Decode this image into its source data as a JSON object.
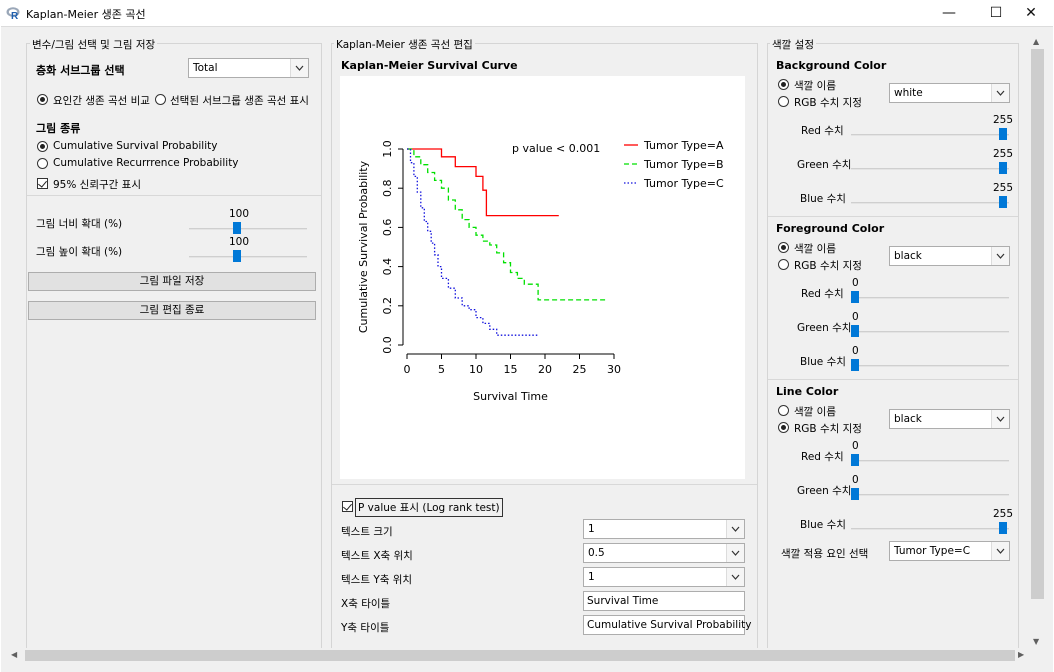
{
  "window": {
    "title": "Kaplan-Meier 생존 곡선",
    "minimize": "—",
    "maximize": "☐",
    "close": "✕"
  },
  "left": {
    "legend": "변수/그림 선택 및 그림 저장",
    "subgroup_label": "층화 서브그룹 선택",
    "subgroup_value": "Total",
    "radio_compare": "요인간 생존 곡선 비교",
    "radio_selected": "선택된 서브그룹 생존 곡선 표시",
    "figure_type_label": "그림 종류",
    "opt_survival": "Cumulative Survival Probability",
    "opt_recurrence": "Cumulative Recurrrence Probability",
    "ci_label": "95% 신뢰구간 표시",
    "width_label": "그림 너비 확대 (%)",
    "width_value": "100",
    "height_label": "그림 높이 확대 (%)",
    "height_value": "100",
    "save_button": "그림 파일 저장",
    "exit_button": "그림 편집 종료"
  },
  "middle": {
    "legend": "Kaplan-Meier 생존 곡선 편집",
    "plot_title": "Kaplan-Meier Survival Curve",
    "pvalue_label": "P value 표시 (Log rank test)",
    "text_size_label": "텍스트 크기",
    "text_size_value": "1",
    "text_x_label": "텍스트 X축 위치",
    "text_x_value": "0.5",
    "text_y_label": "텍스트 Y축 위치",
    "text_y_value": "1",
    "x_title_label": "X축 타이틀",
    "x_title_value": "Survival Time",
    "y_title_label": "Y축 타이틀",
    "y_title_value": "Cumulative Survival Probability"
  },
  "right": {
    "legend": "색깔 설정",
    "bg": {
      "title": "Background Color",
      "radio_name": "색깔 이름",
      "radio_rgb": "RGB 수치 지정",
      "color_value": "white",
      "red_label": "Red 수치",
      "red": "255",
      "green_label": "Green 수치",
      "green": "255",
      "blue_label": "Blue 수치",
      "blue": "255"
    },
    "fg": {
      "title": "Foreground Color",
      "radio_name": "색깔 이름",
      "radio_rgb": "RGB 수치 지정",
      "color_value": "black",
      "red_label": "Red 수치",
      "red": "0",
      "green_label": "Green 수치",
      "green": "0",
      "blue_label": "Blue 수치",
      "blue": "0"
    },
    "line": {
      "title": "Line Color",
      "radio_name": "색깔 이름",
      "radio_rgb": "RGB 수치 지정",
      "color_value": "black",
      "red_label": "Red 수치",
      "red": "0",
      "green_label": "Green 수치",
      "green": "0",
      "blue_label": "Blue 수치",
      "blue": "255"
    },
    "apply_label": "색깔 적용 요인 선택",
    "apply_value": "Tumor Type=C"
  },
  "icons": {
    "app": "r-logo-icon",
    "dropdown": "chevron-down-icon"
  },
  "colors": {
    "accent": "#0078d7",
    "series_a": "#ff0000",
    "series_b": "#00e000",
    "series_c": "#1010dd"
  },
  "chart_data": {
    "type": "line",
    "xlabel": "Survival Time",
    "ylabel": "Cumulative Survival Probability",
    "xlim": [
      0,
      30
    ],
    "ylim": [
      0,
      1
    ],
    "xticks": [
      "0",
      "5",
      "10",
      "15",
      "20",
      "25",
      "30"
    ],
    "yticks": [
      "0.0",
      "0.2",
      "0.4",
      "0.6",
      "0.8",
      "1.0"
    ],
    "annotation": "p value < 0.001",
    "legend_position": "top-right",
    "series": [
      {
        "name": "Tumor Type=A",
        "color": "#ff0000",
        "dash": "",
        "x": [
          0,
          5,
          7,
          10,
          11,
          11.5,
          22
        ],
        "y": [
          1.0,
          0.96,
          0.91,
          0.86,
          0.79,
          0.66,
          0.66
        ]
      },
      {
        "name": "Tumor Type=B",
        "color": "#00e000",
        "dash": "5,3",
        "x": [
          0,
          1,
          2,
          3,
          4,
          5,
          6,
          7,
          8,
          9,
          10,
          11,
          12,
          13,
          14,
          15,
          16,
          17,
          19,
          29
        ],
        "y": [
          1.0,
          0.96,
          0.92,
          0.88,
          0.84,
          0.8,
          0.74,
          0.69,
          0.64,
          0.6,
          0.56,
          0.53,
          0.51,
          0.47,
          0.42,
          0.37,
          0.34,
          0.31,
          0.23,
          0.23
        ]
      },
      {
        "name": "Tumor Type=C",
        "color": "#1010dd",
        "dash": "1.5,2",
        "x": [
          0,
          0.5,
          1,
          1.5,
          2,
          2.5,
          3,
          3.5,
          4,
          4.5,
          5,
          6,
          7,
          8,
          9,
          10,
          11,
          12,
          13,
          19
        ],
        "y": [
          1.0,
          0.93,
          0.86,
          0.78,
          0.7,
          0.63,
          0.58,
          0.52,
          0.46,
          0.4,
          0.34,
          0.29,
          0.24,
          0.2,
          0.18,
          0.14,
          0.11,
          0.08,
          0.05,
          0.05
        ]
      }
    ]
  }
}
